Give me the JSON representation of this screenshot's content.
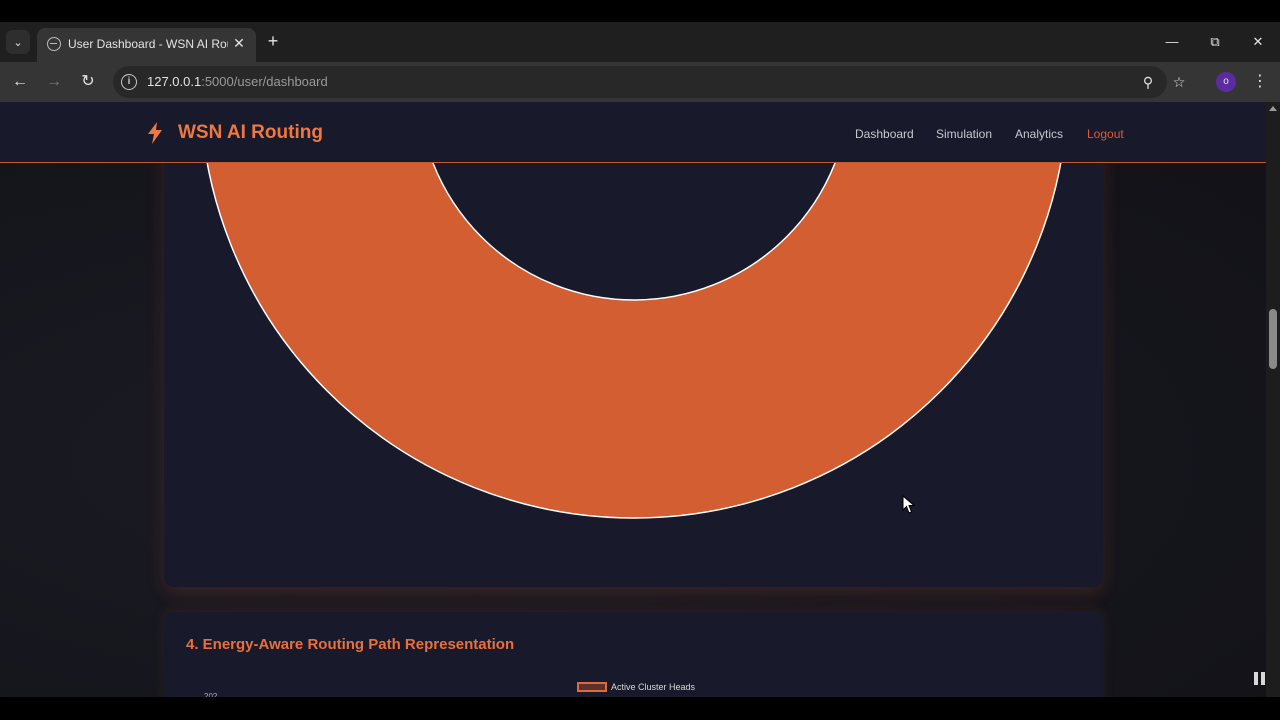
{
  "browser": {
    "tab_title": "User Dashboard - WSN AI Routing",
    "url_host": "127.0.0.1",
    "url_path": ":5000/user/dashboard"
  },
  "app": {
    "brand": "WSN AI Routing",
    "nav": {
      "dashboard": "Dashboard",
      "simulation": "Simulation",
      "analytics": "Analytics",
      "logout": "Logout"
    }
  },
  "section4": {
    "title": "4. Energy-Aware Routing Path Representation"
  },
  "chart_data": [
    {
      "type": "pie",
      "variant": "doughnut",
      "values": [
        1
      ],
      "colors": [
        "#d25e31"
      ],
      "title": "",
      "legend": "none"
    },
    {
      "type": "line",
      "series": [
        {
          "name": "Active Cluster Heads",
          "values": []
        }
      ],
      "ytick_top": "202",
      "legend": "top-center"
    }
  ],
  "colors": {
    "accent": "#ef7840",
    "donut_fill": "#d25e31",
    "card_bg": "#181a2b",
    "logout": "#e0583a"
  }
}
